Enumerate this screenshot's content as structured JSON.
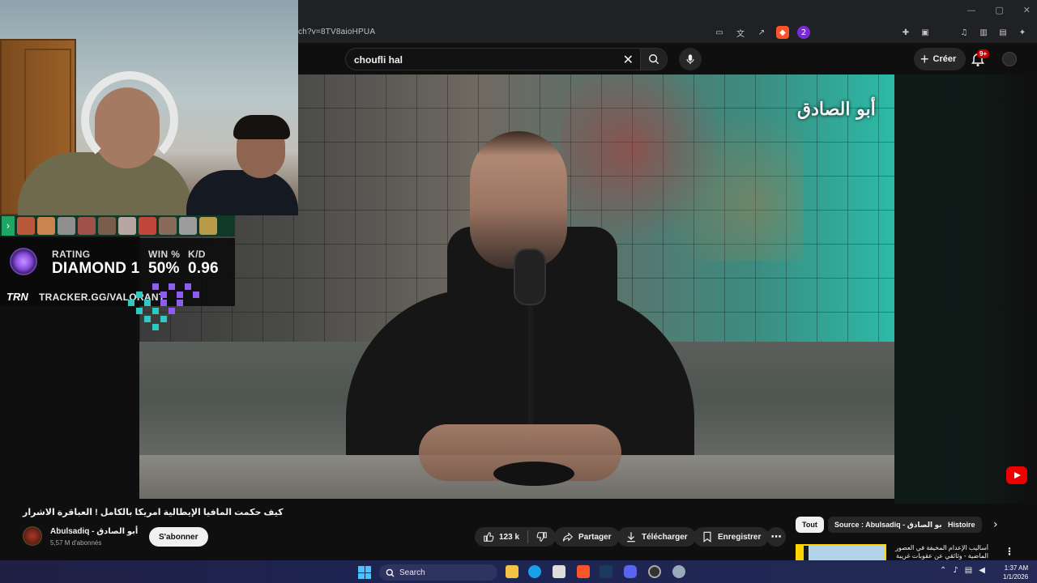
{
  "browser": {
    "url": "ch?v=8TV8aioHPUA",
    "window_controls": [
      "—",
      "▢",
      "✕"
    ],
    "notif_ext_badge": "2"
  },
  "header": {
    "search_value": "choufli hal",
    "create_label": "Créer",
    "notif_badge": "9+"
  },
  "overlay": {
    "rating_label": "RATING",
    "rank": "DIAMOND 1",
    "win_label": "WIN %",
    "win_value": "50%",
    "kd_label": "K/D",
    "kd_value": "0.96",
    "trn_logo": "TRN",
    "tracker_url": "TRACKER.GG/VALORANT"
  },
  "video": {
    "title": "كيف حكمت المافيا الإيطالية امريكا بالكامل ! العباقرة الاشرار",
    "logo_text": "أبو الصادق",
    "channel_name": "Abulsadiq - أبو الصادق",
    "subscribers": "5,57 M d'abonnés",
    "subscribe_label": "S'abonner",
    "likes": "123 k",
    "share_label": "Partager",
    "download_label": "Télécharger",
    "save_label": "Enregistrer"
  },
  "recommendations": {
    "chips": [
      "Tout",
      "Source : Abulsadiq - أبو الصادق",
      "Histoire"
    ],
    "first_title": "أساليب الإعدام المخيفة في العصور الماضية - وثائقي عن عقوبات غريبة"
  },
  "taskbar": {
    "search_label": "Search",
    "time": "1:37 AM",
    "date": "1/1/2026"
  },
  "colors": {
    "yt_background": "#0f0f0f",
    "subscribe_bg": "#f1f1f1",
    "notif_red": "#cc0000",
    "tracker_green": "#1ea665",
    "rank_purple": "#8b4ce6"
  }
}
